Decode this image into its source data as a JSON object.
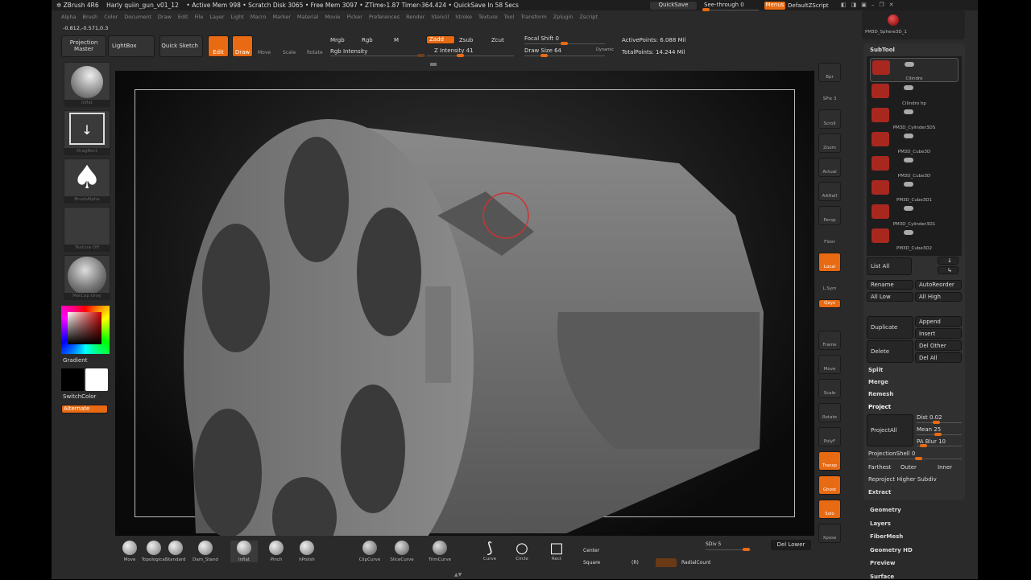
{
  "titlebar": {
    "app": "ZBrush 4R6",
    "document": "Harly quiin_gun_v01_12",
    "active_mem": "• Active Mem 998",
    "scratch": "• Scratch Disk 3065",
    "free_mem": "• Free Mem 3097",
    "ztime": "• ZTime›1.87",
    "timer": "Timer›364.424",
    "quicksave_in": "• QuickSave In 58 Secs"
  },
  "top_right": {
    "quicksave": "QuickSave",
    "see_through": "See-through  0",
    "menus": "Menus",
    "script": "DefaultZScript"
  },
  "menus": [
    "Alpha",
    "Brush",
    "Color",
    "Document",
    "Draw",
    "Edit",
    "File",
    "Layer",
    "Light",
    "Macro",
    "Marker",
    "Material",
    "Movie",
    "Picker",
    "Preferences",
    "Render",
    "Stencil",
    "Stroke",
    "Texture",
    "Tool",
    "Transform",
    "Zplugin",
    "Zscript"
  ],
  "coords": "-0.812,-0.571,0.3",
  "toolbar": {
    "projection_master": "Projection Master",
    "lightbox": "LightBox",
    "quick_sketch": "Quick Sketch",
    "edit": "Edit",
    "draw": "Draw",
    "move": "Move",
    "scale": "Scale",
    "rotate": "Rotate",
    "mrgb": "Mrgb",
    "rgb": "Rgb",
    "m": "M",
    "rgb_intensity": "Rgb Intensity",
    "zadd": "Zadd",
    "zsub": "Zsub",
    "zcut": "Zcut",
    "z_intensity": "Z Intensity 41",
    "focal_shift": "Focal Shift 0",
    "draw_size": "Draw Size 64",
    "dynamic": "Dynamic",
    "active_points": "ActivePoints: 6.088 Mil",
    "total_points": "TotalPoints: 14.244 Mil"
  },
  "sliders": {
    "z_intensity": 41,
    "draw_size": 64,
    "focal_shift": 0,
    "see_through": 0
  },
  "left_shelf": {
    "brush": "Inflat",
    "stroke": "DragRect",
    "alpha": "BrushAlpha",
    "texture": "Texture Off",
    "material": "MatCap Gray",
    "gradient": "Gradient",
    "switch_color": "SwitchColor",
    "alternate": "Alternate"
  },
  "right_shelf": [
    "Bpr",
    "SPix 3",
    "Scroll",
    "Zoom",
    "Actual",
    "AAHalf",
    "Persp",
    "Floor",
    "Local",
    "L.Sym",
    "Qxyz",
    "Frame",
    "Move",
    "Scale",
    "Rotate",
    "PolyF",
    "Transp",
    "Ghost",
    "Solo",
    "Xpose"
  ],
  "right_shelf_active": [
    "Local",
    "Qxyz",
    "Transp",
    "Ghost",
    "Solo"
  ],
  "tool_preview": "PM3D_Sphere3D_1",
  "subtool": {
    "title": "SubTool",
    "items": [
      "Cilindro",
      "Cilindro hp",
      "PM3D_Cylinder3DS",
      "PM3D_Cube3D",
      "PM3D_Cube3D",
      "PM3D_Cube3D1",
      "PM3D_Cylinder3D1",
      "PM3D_Cube3D2"
    ],
    "list_all": "List All",
    "rename": "Rename",
    "autoreorder": "AutoReorder",
    "all_low": "All Low",
    "all_high": "All High",
    "duplicate": "Duplicate",
    "append": "Append",
    "insert": "Insert",
    "delete": "Delete",
    "del_other": "Del Other",
    "del_all": "Del All",
    "split": "Split",
    "merge": "Merge",
    "remesh": "Remesh",
    "project": "Project",
    "project_all": "ProjectAll",
    "dist": "Dist 0.02",
    "mean": "Mean 25",
    "pa_blur": "PA Blur 10",
    "projection_shell": "ProjectionShell 0",
    "farthest": "Farthest",
    "outer": "Outer",
    "inner": "Inner",
    "reproject": "Reproject Higher Subdiv",
    "extract": "Extract"
  },
  "tool_sections": [
    "Geometry",
    "Layers",
    "FiberMesh",
    "Geometry HD",
    "Preview",
    "Surface"
  ],
  "bottom": {
    "brushes": [
      "Move",
      "Topological",
      "Standard",
      "Dam_Stand",
      "Inflat",
      "Pinch",
      "hPolish"
    ],
    "curves": [
      "ClipCurve",
      "SliceCurve",
      "TrimCurve"
    ],
    "shapes": [
      "Curve",
      "Circle",
      "Rect"
    ],
    "center": "Center",
    "square": "Square",
    "r": "(R)",
    "radial": "RadialCount",
    "sdiv": "SDiv 5",
    "del_lower": "Del Lower"
  }
}
